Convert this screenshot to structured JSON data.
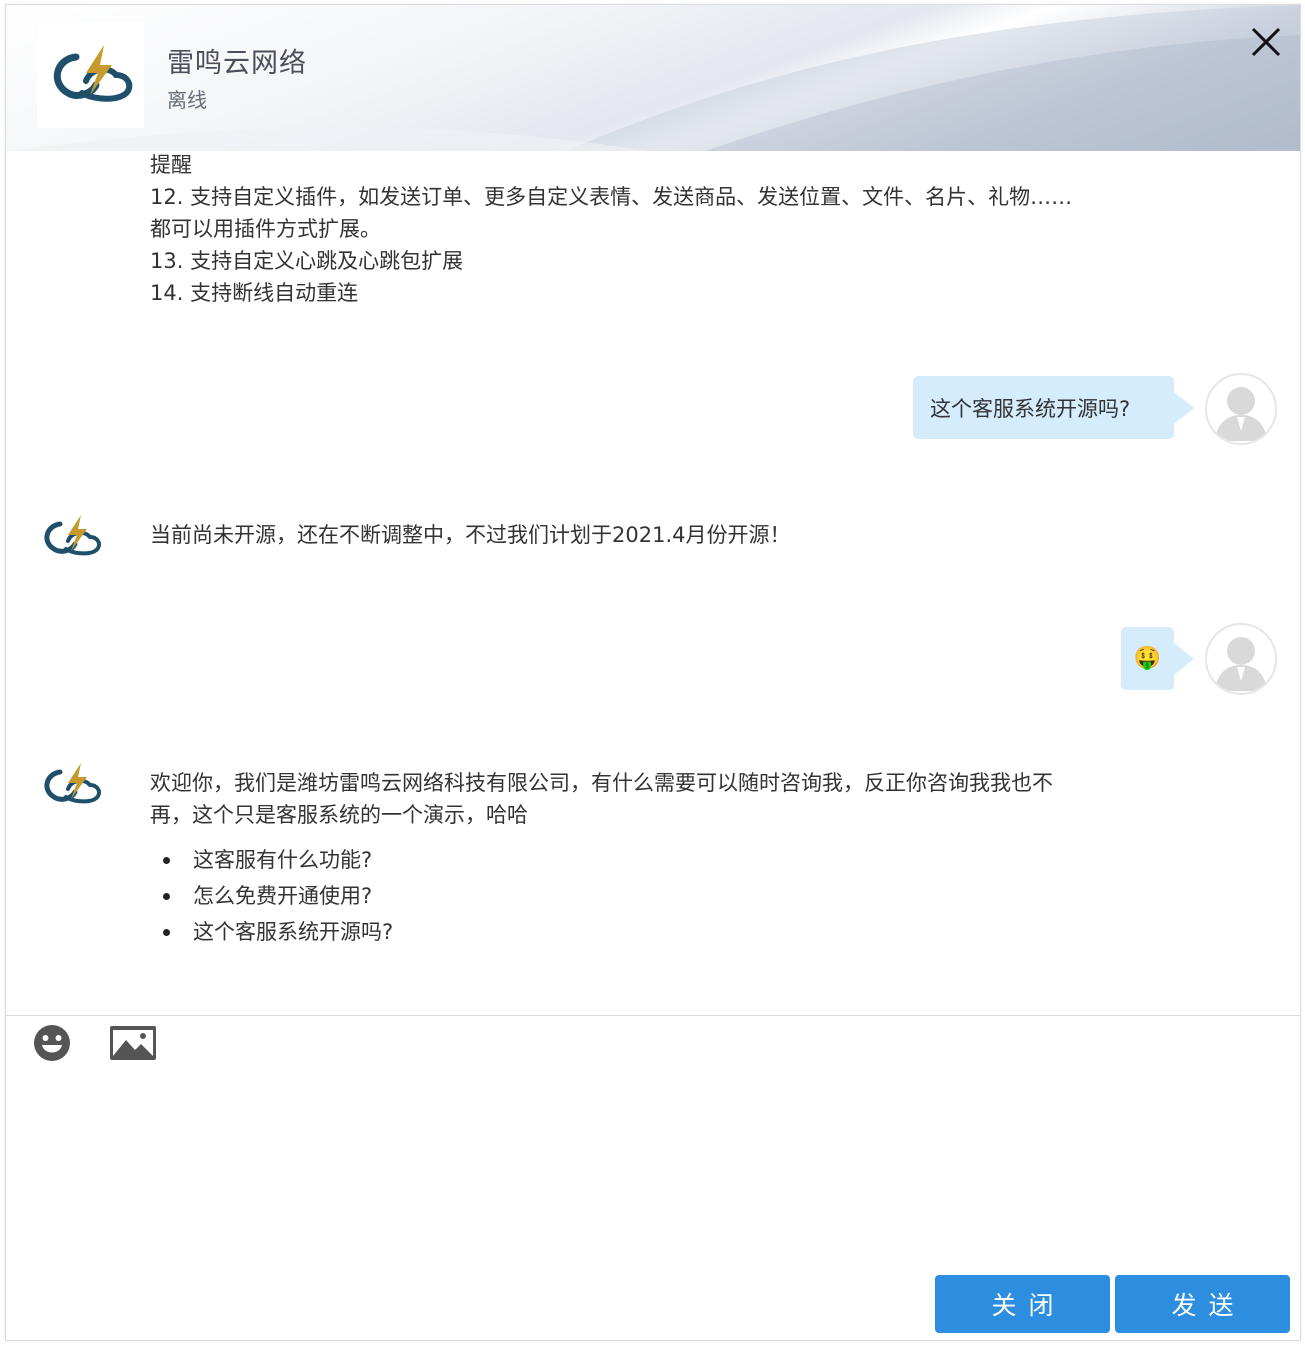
{
  "header": {
    "company_name": "雷鸣云网络",
    "status": "离线"
  },
  "messages": [
    {
      "from": "agent",
      "lines": [
        "提醒",
        "12. 支持自定义插件，如发送订单、更多自定义表情、发送商品、发送位置、文件、名片、礼物……",
        "都可以用插件方式扩展。",
        "13. 支持自定义心跳及心跳包扩展",
        "14. 支持断线自动重连"
      ]
    },
    {
      "from": "user",
      "text": "这个客服系统开源吗?"
    },
    {
      "from": "agent",
      "text": "当前尚未开源，还在不断调整中，不过我们计划于2021.4月份开源！"
    },
    {
      "from": "user",
      "emoji": "🤑"
    },
    {
      "from": "agent",
      "lines": [
        "欢迎你，我们是潍坊雷鸣云网络科技有限公司，有什么需要可以随时咨询我，反正你咨询我我也不",
        "再，这个只是客服系统的一个演示，哈哈"
      ],
      "suggestions": [
        "这客服有什么功能?",
        "怎么免费开通使用?",
        "这个客服系统开源吗?"
      ]
    }
  ],
  "composer": {
    "emoji_icon": "smiley-face-icon",
    "image_icon": "image-icon",
    "close_label": "关闭",
    "send_label": "发送"
  },
  "colors": {
    "accent": "#2d8ee0",
    "user_bubble": "#d4ecfb",
    "logo_dark": "#1f4f6b",
    "logo_gold": "#c79a2e"
  }
}
